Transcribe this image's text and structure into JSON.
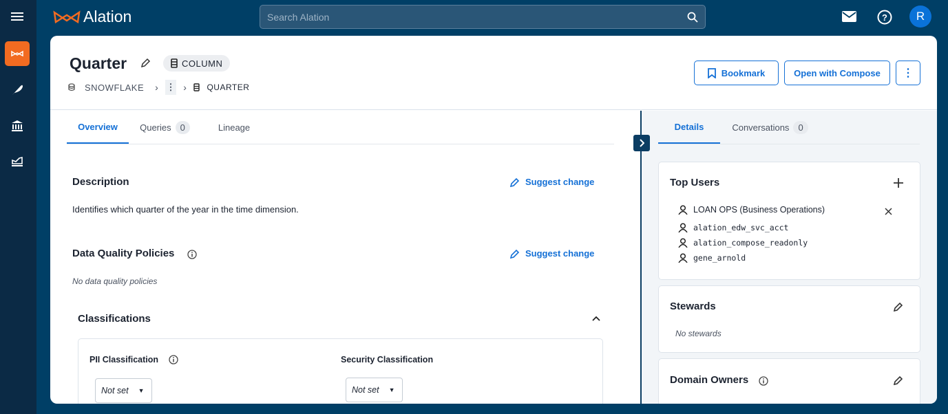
{
  "app": {
    "logo_text": "Alation",
    "search_placeholder": "Search Alation",
    "avatar_initial": "R",
    "accent": "#1470d6",
    "brand_orange": "#f26b21"
  },
  "rail": {
    "items": [
      {
        "icon": "menu-icon"
      },
      {
        "icon": "alation-home-icon",
        "active": true
      },
      {
        "icon": "feather-compose-icon"
      },
      {
        "icon": "catalog-building-icon"
      },
      {
        "icon": "analytics-chart-icon"
      }
    ]
  },
  "header": {
    "title": "Quarter",
    "type_badge": "COLUMN",
    "breadcrumb": [
      "SNOWFLAKE",
      "QUARTER"
    ],
    "actions": {
      "bookmark": "Bookmark",
      "compose": "Open with Compose"
    }
  },
  "main": {
    "tabs": [
      {
        "label": "Overview",
        "active": true
      },
      {
        "label": "Queries",
        "count": "0"
      },
      {
        "label": "Lineage"
      }
    ],
    "description": {
      "title": "Description",
      "suggest": "Suggest change",
      "text": "Identifies which quarter of the year in the time dimension."
    },
    "dq": {
      "title": "Data Quality Policies",
      "suggest": "Suggest change",
      "empty": "No data quality policies"
    },
    "classifications": {
      "title": "Classifications",
      "pii": {
        "label": "PII Classification",
        "value": "Not set"
      },
      "security": {
        "label": "Security Classification",
        "value": "Not set"
      }
    }
  },
  "side": {
    "tabs": [
      {
        "label": "Details",
        "active": true
      },
      {
        "label": "Conversations",
        "count": "0"
      }
    ],
    "top_users": {
      "title": "Top Users",
      "users": [
        "LOAN OPS (Business Operations)",
        "alation_edw_svc_acct",
        "alation_compose_readonly",
        "gene_arnold"
      ]
    },
    "stewards": {
      "title": "Stewards",
      "empty": "No stewards"
    },
    "domain_owners": {
      "title": "Domain Owners"
    }
  }
}
